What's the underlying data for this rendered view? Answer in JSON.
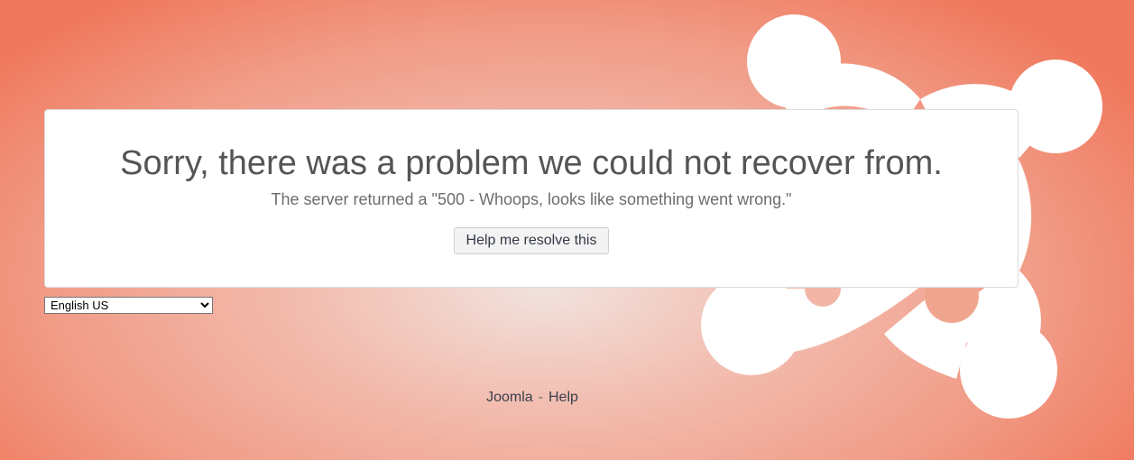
{
  "error": {
    "headline": "Sorry, there was a problem we could not recover from.",
    "message": "The server returned a \"500 - Whoops, looks like something went wrong.\"",
    "help_button_label": "Help me resolve this"
  },
  "language": {
    "selected": "English US",
    "options": [
      "English US"
    ]
  },
  "footer": {
    "link_joomla": "Joomla",
    "separator": "-",
    "link_help": "Help"
  },
  "colors": {
    "background_center": "#f1e3df",
    "background_edge": "#f0785c",
    "card_background": "#ffffff",
    "logo": "#ffffff"
  },
  "icons": {
    "logo": "joomla-logo-icon"
  }
}
